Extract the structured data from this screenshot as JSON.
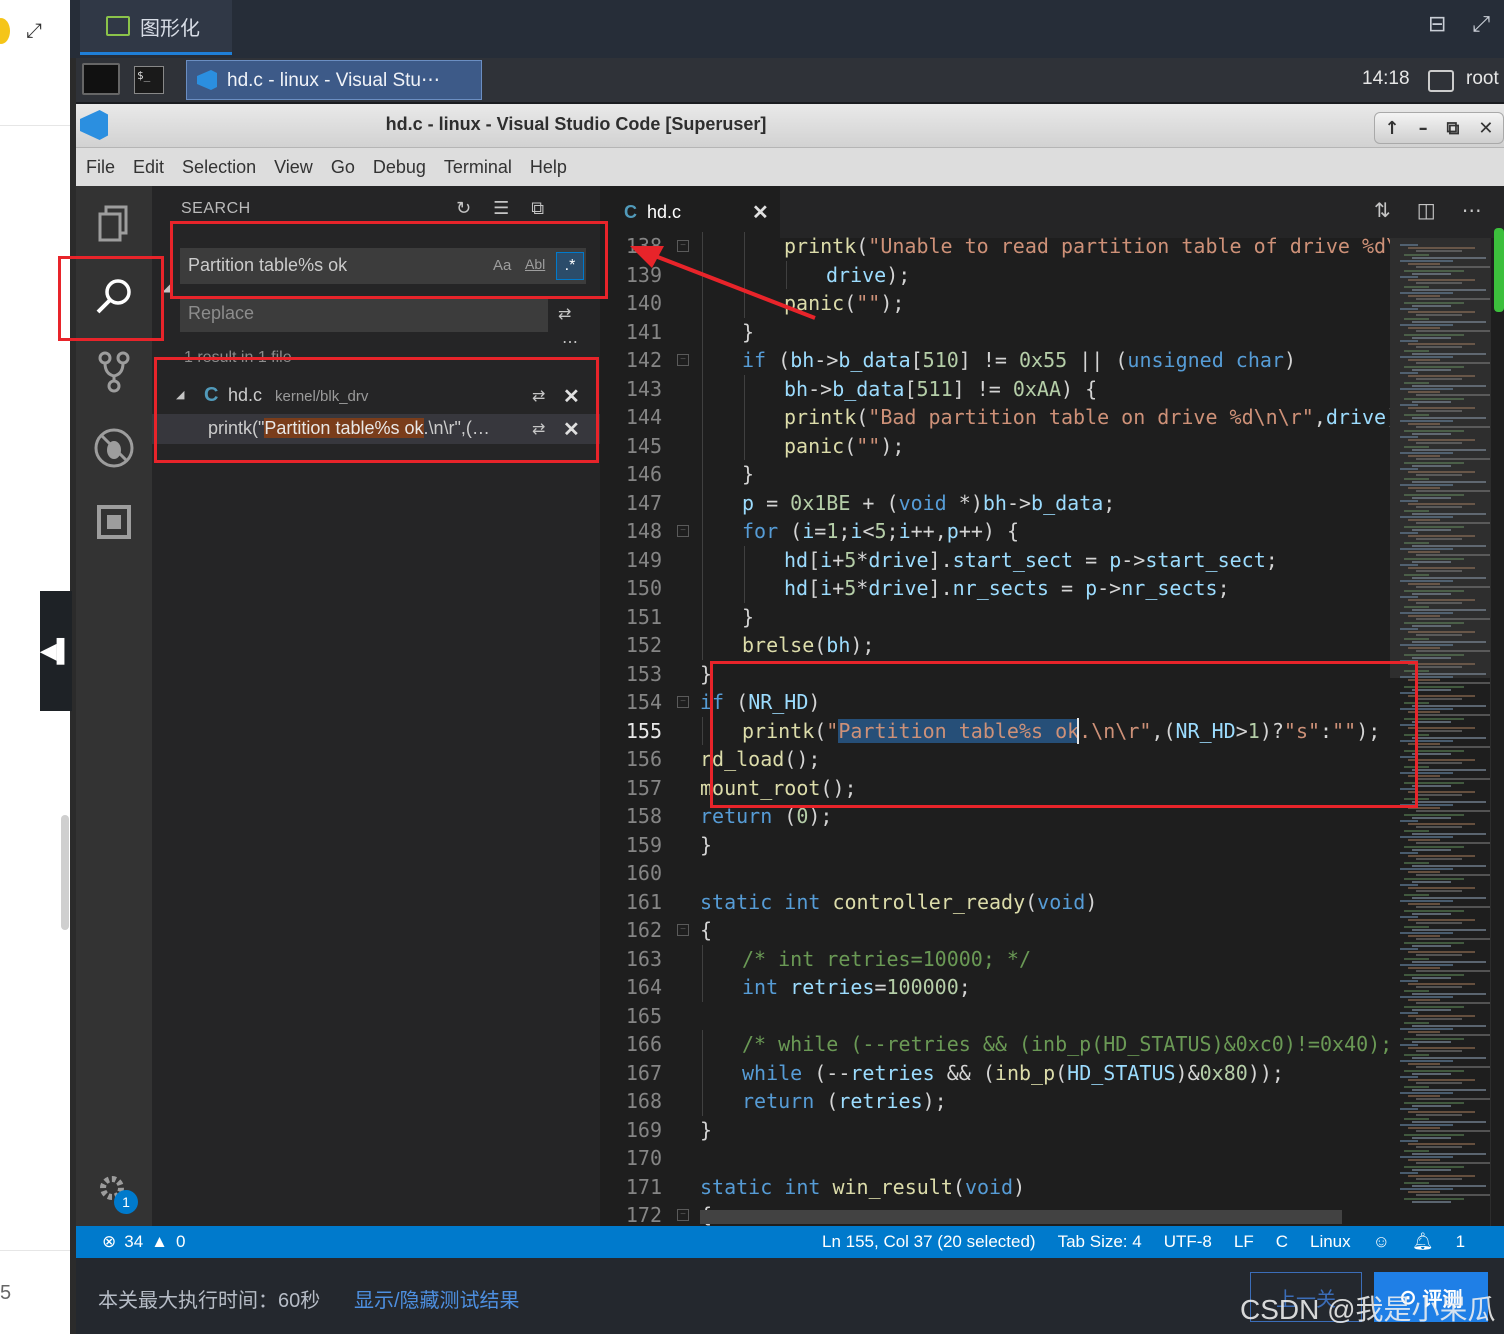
{
  "outer": {
    "expand_icon": "expand-icon",
    "partial_number": "5",
    "collapse_icon": "◀▌"
  },
  "remote_desktop": {
    "tab_label": "图形化",
    "icons": [
      "window-icon",
      "expand-icon"
    ]
  },
  "taskbar": {
    "terminal_glyph": "$_",
    "task_label": "hd.c - linux - Visual Stu⋯",
    "clock": "14:18",
    "user": "root"
  },
  "window": {
    "title": "hd.c - linux - Visual Studio Code [Superuser]",
    "controls": [
      "↑",
      "–",
      "⧉",
      "✕"
    ]
  },
  "menu": [
    "File",
    "Edit",
    "Selection",
    "View",
    "Go",
    "Debug",
    "Terminal",
    "Help"
  ],
  "activity_bar": [
    "explorer-icon",
    "search-icon",
    "source-control-icon",
    "debug-icon",
    "extensions-icon",
    "settings-gear-icon"
  ],
  "settings_badge": "1",
  "search": {
    "header": "SEARCH",
    "query": "Partition table%s ok",
    "match_case": "Aa",
    "whole_word": "Abl",
    "regex": ".*",
    "replace_placeholder": "Replace",
    "more": "⋯",
    "result_summary": "1 result in 1 file",
    "file": {
      "lang": "C",
      "name": "hd.c",
      "path": "kernel/blk_drv"
    },
    "match": {
      "before": "printk(\"",
      "highlight": "Partition table%s ok",
      "after": ".\\n\\r\",(…"
    }
  },
  "editor": {
    "tab": {
      "lang": "C",
      "name": "hd.c"
    },
    "cursor_line": 155,
    "line_numbers": [
      "138",
      "139",
      "140",
      "141",
      "142",
      "143",
      "144",
      "145",
      "146",
      "147",
      "148",
      "149",
      "150",
      "151",
      "152",
      "153",
      "154",
      "155",
      "156",
      "157",
      "158",
      "159",
      "160",
      "161",
      "162",
      "163",
      "164",
      "165",
      "166",
      "167",
      "168",
      "169",
      "170",
      "171",
      "172"
    ],
    "lines": [
      "\t\tprintk(\"Unable to read partition table of drive %d\\n\\r\",",
      "\t\t\tdrive);",
      "\t\tpanic(\"\");",
      "\t}",
      "\tif (bh->b_data[510] != 0x55 || (unsigned char)",
      "\t\tbh->b_data[511] != 0xAA) {",
      "\t\tprintk(\"Bad partition table on drive %d\\n\\r\",drive);",
      "\t\tpanic(\"\");",
      "\t}",
      "\tp = 0x1BE + (void *)bh->b_data;",
      "\tfor (i=1;i<5;i++,p++) {",
      "\t\thd[i+5*drive].start_sect = p->start_sect;",
      "\t\thd[i+5*drive].nr_sects = p->nr_sects;",
      "\t}",
      "\tbrelse(bh);",
      "}",
      "if (NR_HD)",
      "\tprintk(\"Partition table%s ok.\\n\\r\",(NR_HD>1)?\"s\":\"\");",
      "rd_load();",
      "mount_root();",
      "return (0);",
      "}",
      "",
      "static int controller_ready(void)",
      "{",
      "\t/* int retries=10000; */",
      "\tint retries=100000;",
      "",
      "\t/* while (--retries && (inb_p(HD_STATUS)&0xc0)!=0x40); */",
      "\twhile (--retries && (inb_p(HD_STATUS)&0x80));",
      "\treturn (retries);",
      "}",
      "",
      "static int win_result(void)",
      "{"
    ]
  },
  "status": {
    "errors": "34",
    "warnings": "0",
    "position": "Ln 155, Col 37 (20 selected)",
    "tab_size": "Tab Size: 4",
    "encoding": "UTF-8",
    "eol": "LF",
    "language": "C",
    "platform": "Linux",
    "notifications": "1"
  },
  "page_bottom": {
    "info": "本关最大执行时间：60秒",
    "link": "显示/隐藏测试结果",
    "prev_button": "上一关",
    "eval_button": "评测",
    "watermark": "CSDN @我是小呆瓜"
  },
  "colors": {
    "accent": "#007acc",
    "annotation": "#e8242a",
    "selection": "#264f78",
    "match_highlight": "#7a3d1b"
  }
}
